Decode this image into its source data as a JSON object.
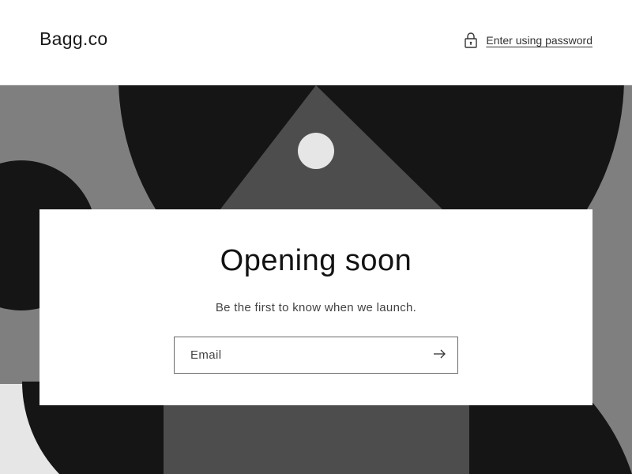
{
  "header": {
    "brand": "Bagg.co",
    "password_link": "Enter using password",
    "lock_icon": "lock-icon"
  },
  "card": {
    "title": "Opening soon",
    "subtitle": "Be the first to know when we launch.",
    "email_placeholder": "Email",
    "submit_icon": "arrow-right-icon"
  },
  "colors": {
    "background": "#ffffff",
    "banner_gray": "#7f7f7f",
    "banner_dark": "#151515",
    "banner_mid": "#4d4d4d",
    "banner_light": "#e6e6e6",
    "text": "#121212"
  }
}
